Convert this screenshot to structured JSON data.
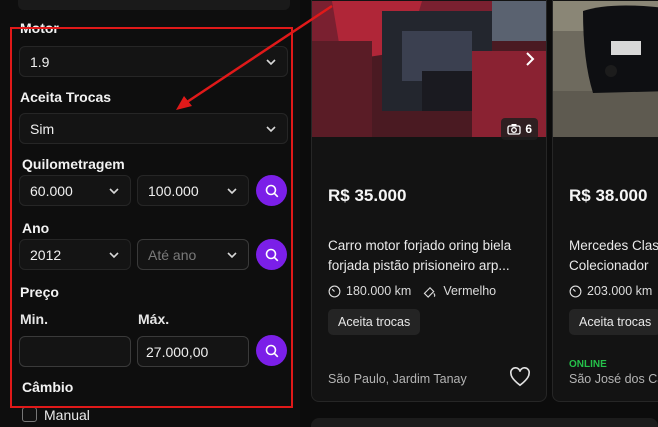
{
  "filters": {
    "motor": {
      "label": "Motor",
      "value": "1.9"
    },
    "aceita_trocas": {
      "label": "Aceita Trocas",
      "value": "Sim"
    },
    "quilometragem": {
      "label": "Quilometragem",
      "min_value": "60.000",
      "max_value": "100.000"
    },
    "ano": {
      "label": "Ano",
      "min_value": "2012",
      "max_placeholder": "Até ano"
    },
    "preco": {
      "label": "Preço",
      "min_label": "Min.",
      "max_label": "Máx.",
      "min_value": "",
      "max_value": "27.000,00"
    },
    "cambio": {
      "label": "Câmbio",
      "option": "Manual"
    }
  },
  "colors": {
    "accent": "#7b1fe8",
    "highlight": "#e01919",
    "online": "#25c24a"
  },
  "listings": [
    {
      "price": "R$ 35.000",
      "title_line1": "Carro motor forjado oring biela",
      "title_line2": "forjada pistão prisioneiro arp...",
      "km": "180.000 km",
      "color": "Vermelho",
      "badge": "Aceita trocas",
      "location": "São Paulo, Jardim Tanay",
      "photo_count": "6"
    },
    {
      "price": "R$ 38.000",
      "title_line1": "Mercedes Clas",
      "title_line2": "Colecionador",
      "km": "203.000 km",
      "badge": "Aceita trocas",
      "status": "ONLINE",
      "location": "São José dos Ca"
    }
  ],
  "icons": [
    "chevron-down-icon",
    "search-icon",
    "camera-icon",
    "chevron-right-icon",
    "speedometer-icon",
    "paint-icon",
    "heart-icon"
  ]
}
